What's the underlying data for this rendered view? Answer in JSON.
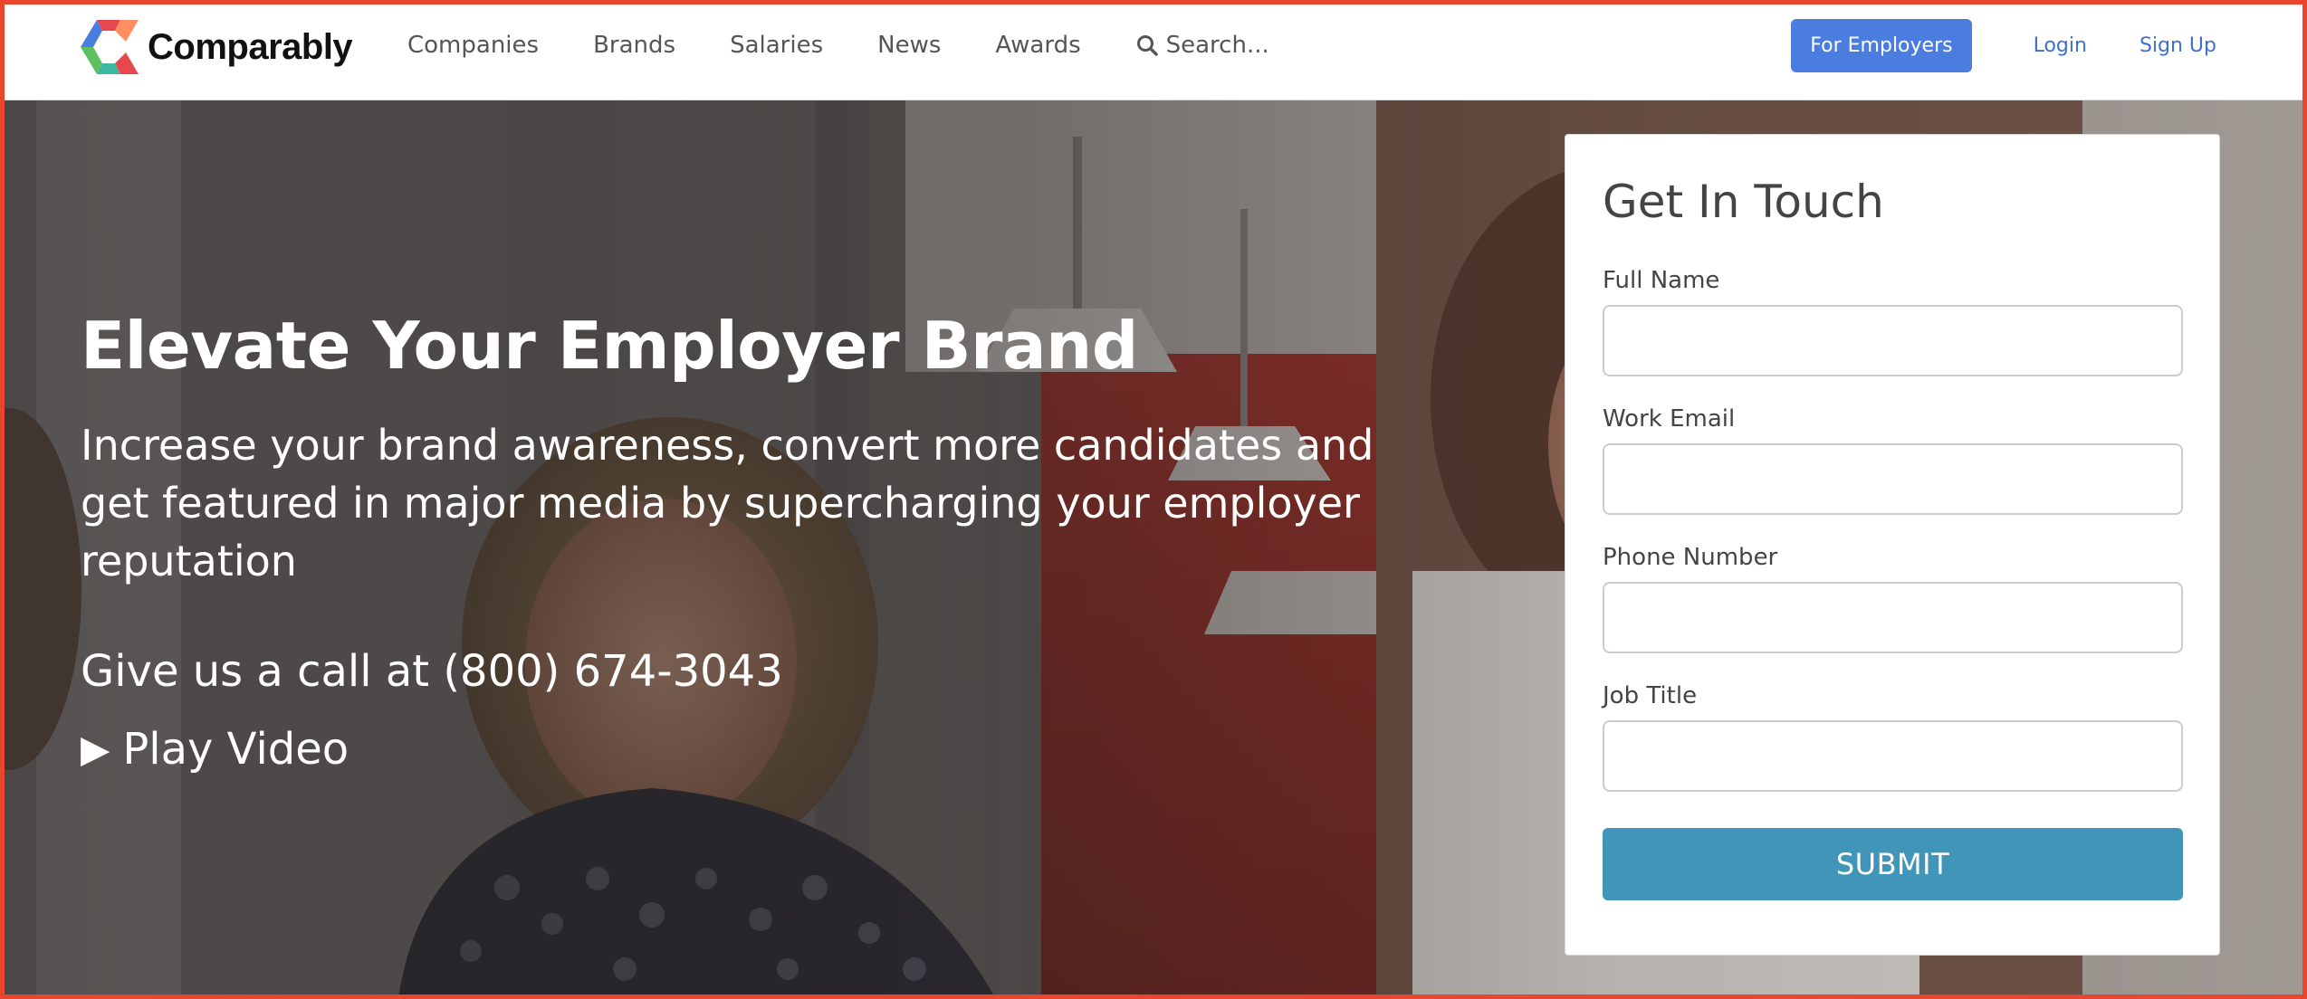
{
  "brand": {
    "name": "Comparably",
    "logo_colors": [
      "#e5484d",
      "#4a7ddf",
      "#5cbf60"
    ]
  },
  "nav": {
    "items": [
      {
        "label": "Companies"
      },
      {
        "label": "Brands"
      },
      {
        "label": "Salaries"
      },
      {
        "label": "News"
      },
      {
        "label": "Awards"
      }
    ],
    "search_label": "Search...",
    "search_icon": "search-icon",
    "for_employers": "For Employers",
    "login": "Login",
    "signup": "Sign Up"
  },
  "hero": {
    "title": "Elevate Your Employer Brand",
    "subtitle": "Increase your brand awareness, convert more candidates and get featured in major media by supercharging your employer reputation",
    "phone_prefix": "Give us a call at ",
    "phone_number": "(800) 674-3043",
    "play_icon": "▶",
    "play_label": "Play Video"
  },
  "contact_form": {
    "heading": "Get In Touch",
    "fields": [
      {
        "label": "Full Name",
        "value": "",
        "placeholder": ""
      },
      {
        "label": "Work Email",
        "value": "",
        "placeholder": ""
      },
      {
        "label": "Phone Number",
        "value": "",
        "placeholder": ""
      },
      {
        "label": "Job Title",
        "value": "",
        "placeholder": ""
      }
    ],
    "submit_label": "SUBMIT"
  },
  "colors": {
    "primary_button": "#4a7ddf",
    "submit_button": "#4195b8",
    "link": "#3f6fd0",
    "frame_border": "#e8462f"
  }
}
